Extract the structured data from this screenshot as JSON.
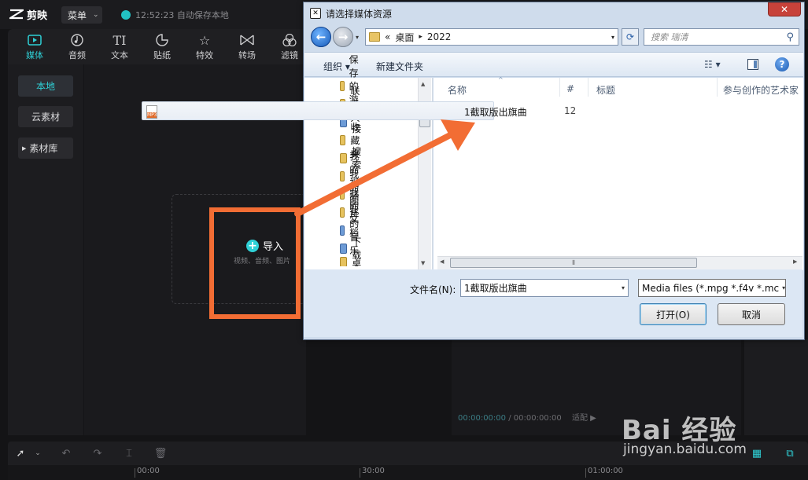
{
  "app": {
    "logo_text": "剪映",
    "menu_label": "菜单",
    "autosave_text": "12:52:23 自动保存本地",
    "tools": [
      "媒体",
      "音频",
      "文本",
      "贴纸",
      "特效",
      "转场",
      "滤镜"
    ],
    "left_nav": {
      "local": "本地",
      "cloud": "云素材",
      "library": "素材库"
    },
    "import": {
      "label": "导入",
      "sub": "视频、音频、图片"
    },
    "player_time": {
      "current": "00:00:00:00",
      "total": "/ 00:00:00:00",
      "ratio_label": "适配"
    },
    "ruler_ticks": [
      "00:00",
      "30:00",
      "01:00:00"
    ],
    "accent_color": "#2fd0d6"
  },
  "dialog": {
    "title": "请选择媒体资源",
    "close_label": "✕",
    "breadcrumb": {
      "prefix": "«",
      "part1": "桌面",
      "sep": "▸",
      "part2": "2022"
    },
    "search_placeholder": "搜索 瑞清",
    "organize": "组织 ▾",
    "new_folder": "新建文件夹",
    "nav_items": [
      "保存的游戏",
      "联系人",
      "链接",
      "收藏夹",
      "搜索",
      "我的视频",
      "我的图片",
      "我的文档",
      "我的音乐",
      "下载",
      "桌面"
    ],
    "columns": {
      "name": "名称",
      "num": "#",
      "title": "标题",
      "artist": "参与创作的艺术家"
    },
    "file": {
      "name": "1截取版出旗曲",
      "num": "12",
      "icon_badge": "MP3"
    },
    "filename_label": "文件名(N):",
    "filename_value": "1截取版出旗曲",
    "filter_value": "Media files (*.mpg *.f4v *.mc",
    "open_label": "打开(O)",
    "cancel_label": "取消"
  },
  "watermark": {
    "line1": "Bai 经验",
    "line2": "jingyan.baidu.com"
  },
  "annotation_color": "#f26d34"
}
